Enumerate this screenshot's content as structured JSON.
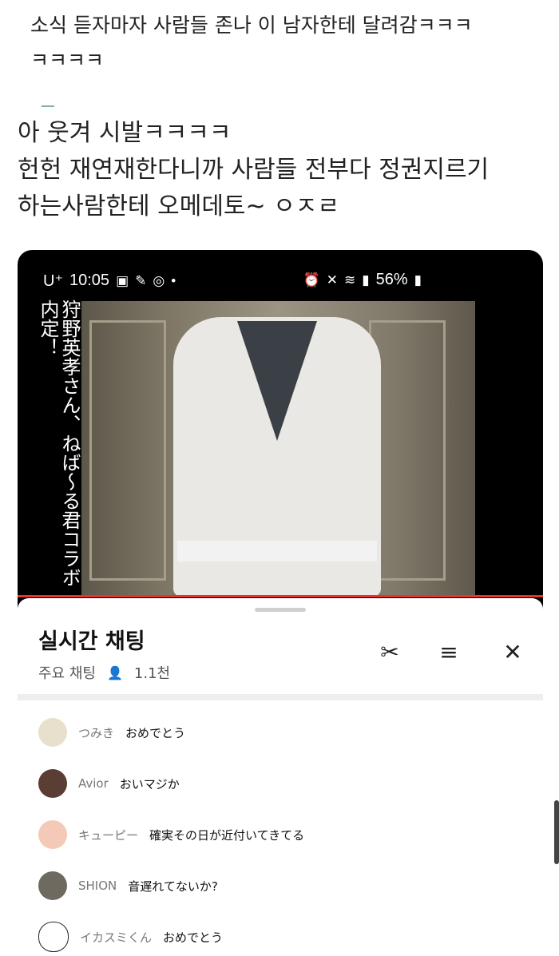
{
  "post": {
    "line1": "소식 듣자마자 사람들 존나 이 남자한테 달려감ㅋㅋㅋ",
    "line2": "ㅋㅋㅋㅋ",
    "line3": "아 웃겨 시발ㅋㅋㅋㅋ",
    "line4": "헌헌 재연재한다니까 사람들 전부다 정권지르기",
    "line5": "하는사람한테 오메데토~ ㅇㅈㄹ"
  },
  "status_bar": {
    "carrier": "U⁺",
    "time": "10:05",
    "battery": "56%"
  },
  "video": {
    "caption": "狩野英孝さん、ねば〜る君コラボ内定！"
  },
  "chat": {
    "title": "실시간 채팅",
    "mode": "주요 채팅",
    "viewers": "1.1천",
    "messages": [
      {
        "author": "つみき",
        "text": "おめでとう",
        "avatar_color": "#e8e0cc"
      },
      {
        "author": "Avior",
        "text": "おいマジか",
        "avatar_color": "#5a3d33"
      },
      {
        "author": "キューピー",
        "text": "確実その日が近付いてきてる",
        "avatar_color": "#f4c9b8"
      },
      {
        "author": "SHION",
        "text": "音遅れてないか?",
        "avatar_color": "#6e6a60"
      },
      {
        "author": "イカスミくん",
        "text": "おめでとう",
        "avatar_color": "#ffffff"
      }
    ]
  },
  "colors": {
    "accent_red": "#e8322c",
    "phone_bg": "#000000"
  },
  "icons": [
    "image-icon",
    "mic-icon",
    "instagram-icon",
    "alarm-icon",
    "mute-icon",
    "wifi-icon",
    "signal-icon",
    "battery-icon",
    "scissors-icon",
    "filter-icon",
    "close-icon",
    "person-icon"
  ]
}
